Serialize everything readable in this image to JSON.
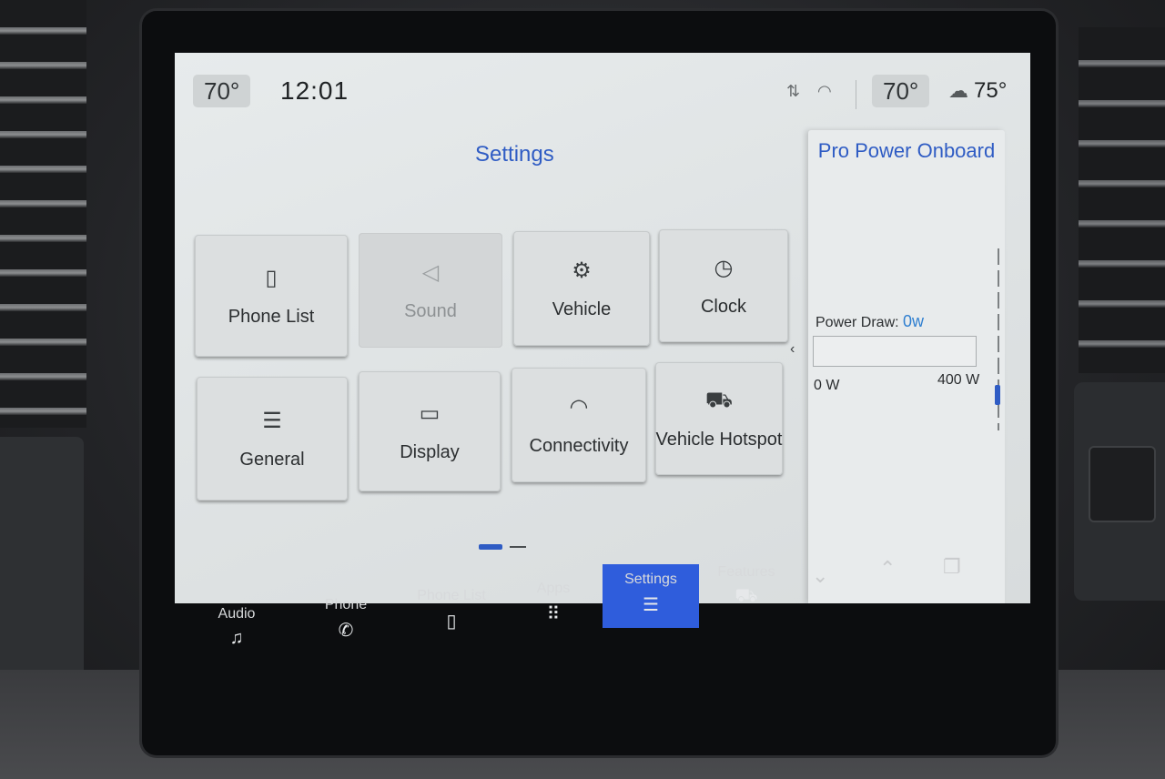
{
  "status": {
    "left_temp": "70°",
    "time": "12:01",
    "right_temp": "70°",
    "outside_temp": "75°",
    "icons": [
      "data-transfer-icon",
      "wifi-icon",
      "weather-icon"
    ]
  },
  "settings": {
    "title": "Settings",
    "tiles": [
      {
        "label": "Phone List",
        "icon": "phone-list-icon",
        "glyph": "▯"
      },
      {
        "label": "Sound",
        "icon": "speaker-icon",
        "glyph": "◁",
        "disabled": true
      },
      {
        "label": "Vehicle",
        "icon": "vehicle-settings-icon",
        "glyph": "⚙"
      },
      {
        "label": "Clock",
        "icon": "clock-icon",
        "glyph": "◷"
      },
      {
        "label": "General",
        "icon": "sliders-icon",
        "glyph": "☰"
      },
      {
        "label": "Display",
        "icon": "display-icon",
        "glyph": "▭"
      },
      {
        "label": "Connectivity",
        "icon": "wifi-icon",
        "glyph": "◠"
      },
      {
        "label": "Vehicle Hotspot",
        "icon": "hotspot-truck-icon",
        "glyph": "⛟"
      }
    ],
    "page": {
      "current": 1,
      "total": 2
    }
  },
  "power": {
    "title": "Pro Power Onboard",
    "draw_label": "Power Draw:",
    "draw_value": "0w",
    "draw_fraction": 0,
    "min_label": "0 W",
    "max_label": "400 W"
  },
  "nav": {
    "items": [
      {
        "label": "Audio",
        "icon": "music-note-icon",
        "glyph": "♫"
      },
      {
        "label": "Phone",
        "icon": "phone-icon",
        "glyph": "✆"
      },
      {
        "label": "Phone List",
        "icon": "phone-list-icon",
        "glyph": "▯"
      },
      {
        "label": "Apps",
        "icon": "apps-grid-icon",
        "glyph": "⠿"
      },
      {
        "label": "Settings",
        "icon": "sliders-icon",
        "glyph": "☰",
        "active": true
      },
      {
        "label": "Features",
        "icon": "truck-icon",
        "glyph": "⛟"
      }
    ],
    "controls": [
      "chevron-down-icon",
      "chevron-up-icon",
      "copy-icon"
    ]
  },
  "colors": {
    "accent": "#2f5cc4",
    "active_nav": "#2f5ddc",
    "screen_bg": "#e3e6e7"
  }
}
